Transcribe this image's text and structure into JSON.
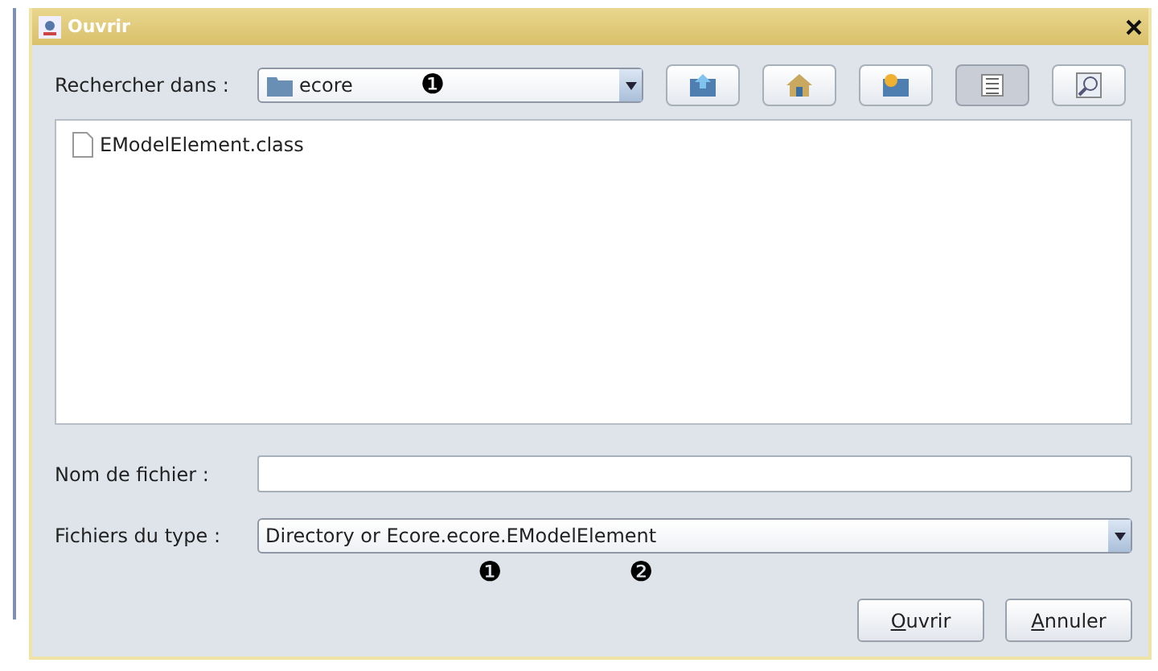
{
  "window": {
    "title": "Ouvrir"
  },
  "look_in": {
    "label": "Rechercher dans :",
    "value": "ecore",
    "annotation": "❶"
  },
  "toolbar": [
    {
      "kind": "up",
      "selected": false
    },
    {
      "kind": "home",
      "selected": false
    },
    {
      "kind": "new-folder",
      "selected": false
    },
    {
      "kind": "list",
      "selected": true
    },
    {
      "kind": "details",
      "selected": false
    }
  ],
  "files": [
    {
      "name": "EModelElement.class",
      "selected": false
    }
  ],
  "file_name": {
    "label": "Nom de fichier :"
  },
  "file_type": {
    "label": "Fichiers du type :",
    "value": "Directory or Ecore.ecore.EModelElement",
    "annotations": [
      "❶",
      "❷"
    ]
  },
  "buttons": [
    {
      "label": "Ouvrir",
      "mnemonic_first": true
    },
    {
      "label": "Annuler",
      "mnemonic_first": true
    }
  ]
}
